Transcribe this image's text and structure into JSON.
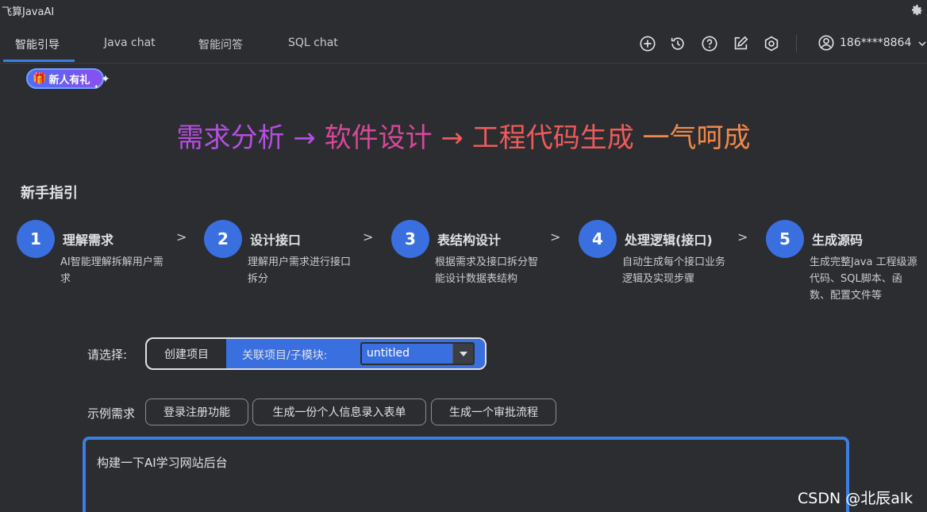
{
  "window": {
    "title": "飞算JavaAI"
  },
  "tabs": [
    {
      "label": "智能引导",
      "active": true
    },
    {
      "label": "Java chat",
      "active": false
    },
    {
      "label": "智能问答",
      "active": false
    },
    {
      "label": "SQL chat",
      "active": false
    }
  ],
  "toolbar": {
    "icons": [
      "add-circle-icon",
      "history-icon",
      "help-icon",
      "edit-icon",
      "settings-hex-icon"
    ],
    "user": {
      "icon": "user-icon",
      "phone": "186****8864"
    }
  },
  "badge": {
    "text": "新人有礼",
    "icon": "gift-icon"
  },
  "headline": {
    "part1": "需求分析",
    "arrow1": " → ",
    "part2": "软件设计",
    "arrow2": " → ",
    "part3": "工程代码生成",
    "part4": " 一气呵成"
  },
  "guide": {
    "title": "新手指引",
    "arrow": ">",
    "steps": [
      {
        "num": "1",
        "title": "理解需求",
        "desc": "AI智能理解拆解用户需求"
      },
      {
        "num": "2",
        "title": "设计接口",
        "desc": "理解用户需求进行接口拆分"
      },
      {
        "num": "3",
        "title": "表结构设计",
        "desc": "根据需求及接口拆分智能设计数据表结构"
      },
      {
        "num": "4",
        "title": "处理逻辑(接口)",
        "desc": "自动生成每个接口业务逻辑及实现步骤"
      },
      {
        "num": "5",
        "title": "生成源码",
        "desc": "生成完整Java 工程级源代码、SQL脚本、函数、配置文件等"
      }
    ]
  },
  "select": {
    "label": "请选择:",
    "create_label": "创建项目",
    "link_label": "关联项目/子模块:",
    "combo_value": "untitled"
  },
  "examples": {
    "label": "示例需求",
    "chips": [
      "登录注册功能",
      "生成一份个人信息录入表单",
      "生成一个审批流程"
    ]
  },
  "prompt": {
    "value": "构建一下AI学习网站后台"
  },
  "watermark": "CSDN @北辰alk",
  "colors": {
    "accent": "#3a6fe0",
    "background": "#2b2d30"
  }
}
